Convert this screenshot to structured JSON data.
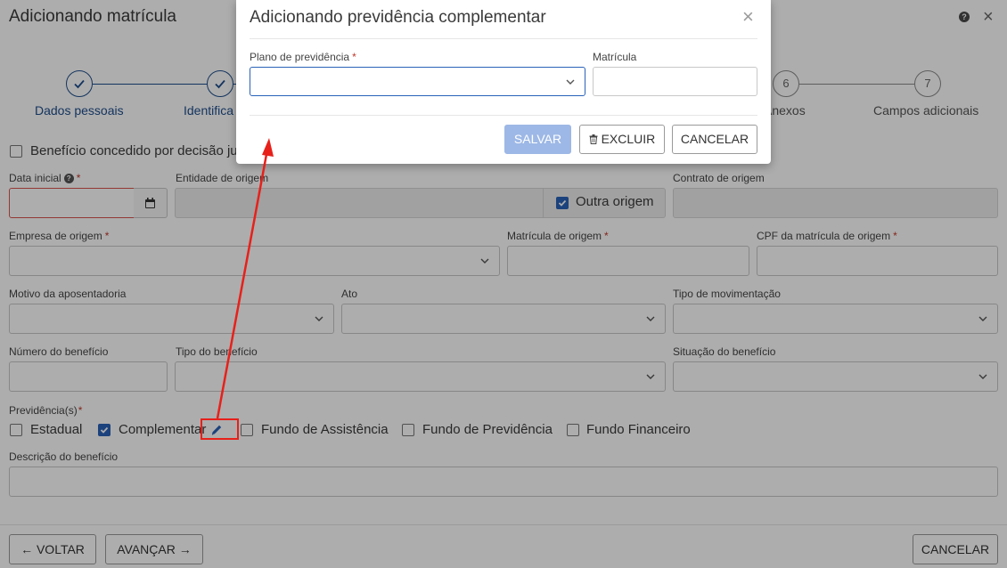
{
  "page": {
    "title": "Adicionando matrícula",
    "help_icon": "?",
    "close_icon": "×"
  },
  "stepper": {
    "steps": [
      {
        "label": "Dados pessoais",
        "icon": "check-icon",
        "state": "done"
      },
      {
        "label": "Identifica",
        "icon": "check-icon",
        "state": "done"
      },
      {
        "label": "Anexos",
        "number": "6",
        "state": "pending"
      },
      {
        "label": "Campos adicionais",
        "number": "7",
        "state": "pending"
      }
    ]
  },
  "form": {
    "beneficio_judicial_label": "Benefício concedido por decisão ju",
    "beneficio_judicial_checked": false,
    "data_inicial_label": "Data inicial",
    "data_inicial_value": "",
    "entidade_origem_label": "Entidade de origem",
    "entidade_origem_value": "",
    "outra_origem_label": "Outra origem",
    "outra_origem_checked": true,
    "contrato_origem_label": "Contrato de origem",
    "contrato_origem_value": "",
    "empresa_origem_label": "Empresa de origem",
    "empresa_origem_value": "",
    "matricula_origem_label": "Matrícula de origem",
    "matricula_origem_value": "",
    "cpf_matricula_label": "CPF da matrícula de origem",
    "cpf_matricula_value": "",
    "motivo_aposentadoria_label": "Motivo da aposentadoria",
    "motivo_aposentadoria_value": "",
    "ato_label": "Ato",
    "ato_value": "",
    "tipo_movimentacao_label": "Tipo de movimentação",
    "tipo_movimentacao_value": "",
    "numero_beneficio_label": "Número do benefício",
    "numero_beneficio_value": "",
    "tipo_beneficio_label": "Tipo do benefício",
    "tipo_beneficio_value": "",
    "situacao_beneficio_label": "Situação do benefício",
    "situacao_beneficio_value": "",
    "previdencias_label": "Previdência(s)",
    "previdencias": [
      {
        "label": "Estadual",
        "checked": false
      },
      {
        "label": "Complementar",
        "checked": true
      },
      {
        "label": "Fundo de Assistência",
        "checked": false
      },
      {
        "label": "Fundo de Previdência",
        "checked": false
      },
      {
        "label": "Fundo Financeiro",
        "checked": false
      }
    ],
    "descricao_beneficio_label": "Descrição do benefício",
    "descricao_beneficio_value": ""
  },
  "footer": {
    "voltar_label": "VOLTAR",
    "avancar_label": "AVANÇAR",
    "cancelar_label": "CANCELAR"
  },
  "modal": {
    "title": "Adicionando previdência complementar",
    "close_icon": "×",
    "plano_label": "Plano de previdência",
    "plano_value": "",
    "matricula_label": "Matrícula",
    "matricula_value": "",
    "salvar_label": "SALVAR",
    "excluir_label": "EXCLUIR",
    "cancelar_label": "CANCELAR"
  },
  "colors": {
    "accent": "#1e4d8c",
    "checkbox": "#2962b8",
    "required": "#c0392b",
    "annotation": "#e8201a",
    "primary_disabled": "#9db8e6"
  }
}
